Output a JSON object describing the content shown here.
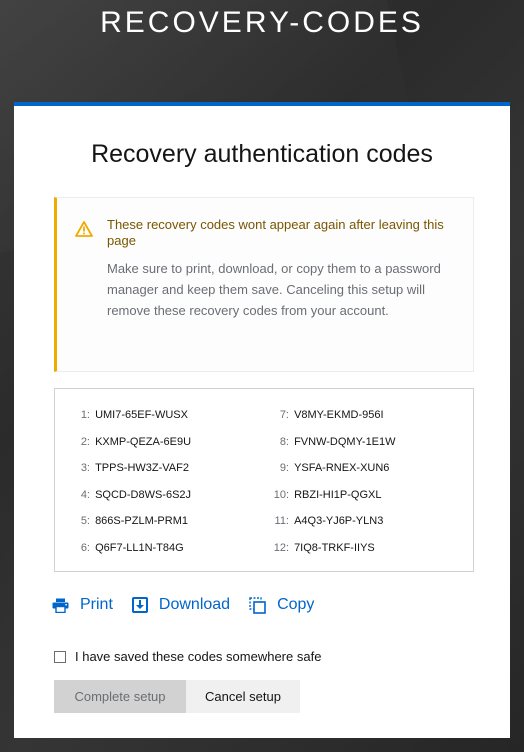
{
  "header": {
    "title": "RECOVERY-CODES"
  },
  "card": {
    "title": "Recovery authentication codes",
    "alert": {
      "title": "These recovery codes wont appear again after leaving this page",
      "body": "Make sure to print, download, or copy them to a password manager and keep them save. Canceling this setup will remove these recovery codes from your account.",
      "icon": "warning-triangle-icon",
      "accent_color": "#f0ab00"
    },
    "codes_left": [
      {
        "num": "1:",
        "code": "UMI7-65EF-WUSX"
      },
      {
        "num": "2:",
        "code": "KXMP-QEZA-6E9U"
      },
      {
        "num": "3:",
        "code": "TPPS-HW3Z-VAF2"
      },
      {
        "num": "4:",
        "code": "SQCD-D8WS-6S2J"
      },
      {
        "num": "5:",
        "code": "866S-PZLM-PRM1"
      },
      {
        "num": "6:",
        "code": "Q6F7-LL1N-T84G"
      }
    ],
    "codes_right": [
      {
        "num": "7:",
        "code": "V8MY-EKMD-956I"
      },
      {
        "num": "8:",
        "code": "FVNW-DQMY-1E1W"
      },
      {
        "num": "9:",
        "code": "YSFA-RNEX-XUN6"
      },
      {
        "num": "10:",
        "code": "RBZI-HI1P-QGXL"
      },
      {
        "num": "11:",
        "code": "A4Q3-YJ6P-YLN3"
      },
      {
        "num": "12:",
        "code": "7IQ8-TRKF-IIYS"
      }
    ],
    "actions": {
      "print_label": "Print",
      "download_label": "Download",
      "copy_label": "Copy",
      "link_color": "#0066cc"
    },
    "confirm_label": "I have saved these codes somewhere safe",
    "confirm_checked": false,
    "complete_button": "Complete setup",
    "cancel_button": "Cancel setup"
  }
}
